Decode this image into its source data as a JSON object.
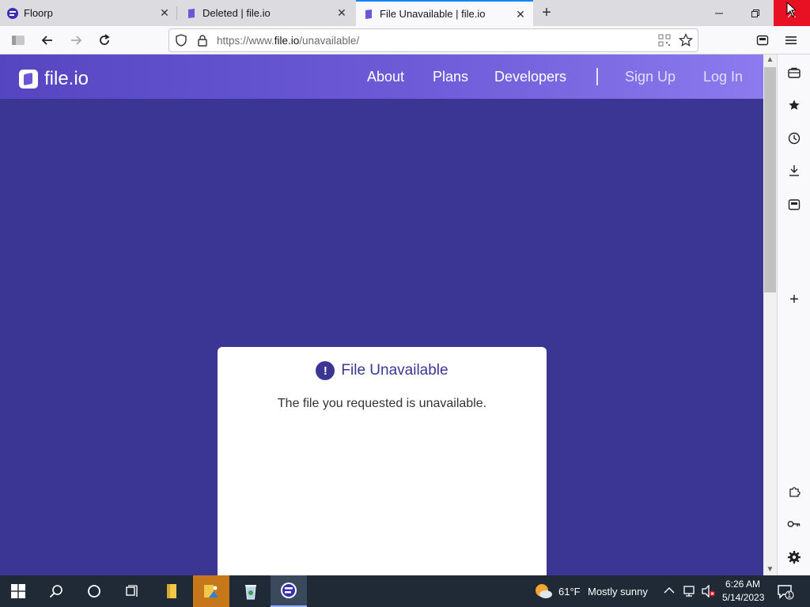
{
  "browser": {
    "tabs": [
      {
        "title": "Floorp",
        "icon": "floorp-icon"
      },
      {
        "title": "Deleted | file.io",
        "icon": "fileio-favicon"
      },
      {
        "title": "File Unavailable | file.io",
        "icon": "fileio-favicon"
      }
    ],
    "address": {
      "prefix": "https://www.",
      "host": "file.io",
      "path": "/unavailable/"
    }
  },
  "site": {
    "logo_text": "file.io",
    "nav": {
      "about": "About",
      "plans": "Plans",
      "developers": "Developers",
      "sign_up": "Sign Up",
      "log_in": "Log In"
    },
    "card": {
      "title": "File Unavailable",
      "message": "The file you requested is unavailable."
    },
    "colors": {
      "page_bg": "#3b3694",
      "header_start": "#5546c0",
      "header_end": "#8c7aee",
      "accent": "#3b3694"
    }
  },
  "taskbar": {
    "weather": {
      "temp": "61°F",
      "condition": "Mostly sunny"
    },
    "clock": {
      "time": "6:26 AM",
      "date": "5/14/2023"
    },
    "notification_count": "1"
  }
}
